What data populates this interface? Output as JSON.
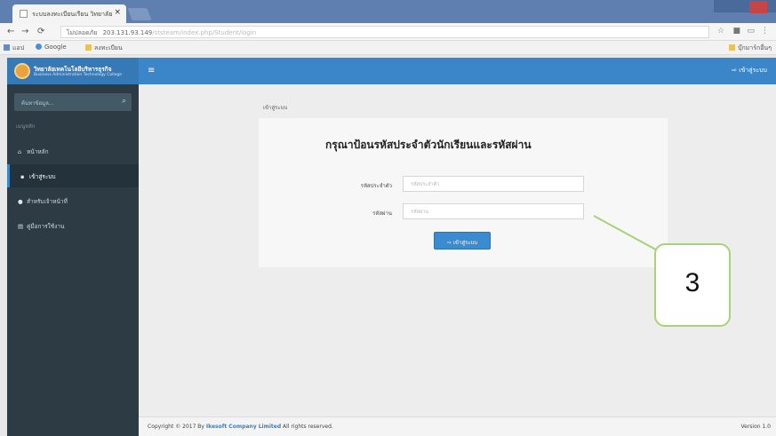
{
  "browser": {
    "tab_title": "ระบบลงทะเบียนเรียน วิทยาลัย",
    "tab_close": "×",
    "url_secure": "ไม่ปลอดภัย",
    "url": "203.131.93.149",
    "url_path": "/ststeam/index.php/Student/login",
    "bookmarks": [
      "แอป",
      "Google",
      "ลงทะเบียน"
    ],
    "other_bookmarks": "บุ๊กมาร์กอื่นๆ"
  },
  "header": {
    "brand_name": "วิทยาลัยเทคโนโลยีบริหารธุรกิจ",
    "brand_sub": "Business Administration Technology College",
    "login_label": "เข้าสู่ระบบ"
  },
  "sidebar": {
    "search_placeholder": "ค้นหาข้อมูล...",
    "menu_header": "เมนูหลัก",
    "items": [
      {
        "label": "หน้าหลัก",
        "icon": "home-icon"
      },
      {
        "label": "เข้าสู่ระบบ",
        "icon": "lock-icon"
      },
      {
        "label": "สำหรับเจ้าหน้าที่",
        "icon": "user-icon"
      },
      {
        "label": "คู่มือการใช้งาน",
        "icon": "book-icon"
      }
    ]
  },
  "main": {
    "breadcrumb": "เข้าสู่ระบบ",
    "title": "กรุณาป้อนรหัสประจำตัวนักเรียนและรหัสผ่าน",
    "student_id_label": "รหัสประจำตัว",
    "student_id_placeholder": "รหัสประจำตัว",
    "password_label": "รหัสผ่าน",
    "password_placeholder": "รหัสผ่าน",
    "submit_label": "เข้าสู่ระบบ"
  },
  "footer": {
    "copyright": "Copyright © 2017 By",
    "company": "Ikesoft Company Limited",
    "rights": "All rights reserved.",
    "version": "Version 1.0"
  },
  "callout": {
    "number": "3"
  },
  "colors": {
    "header_blue": "#3a86c8",
    "sidebar_dark": "#2c3b44",
    "button_blue": "#3a8bd0",
    "callout_border": "#a8d27a"
  }
}
